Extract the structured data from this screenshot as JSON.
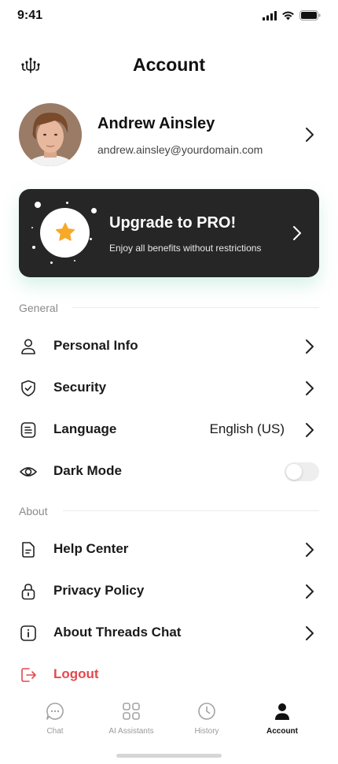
{
  "status_bar": {
    "time": "9:41"
  },
  "header": {
    "title": "Account",
    "logo_icon": "app-logo-icon"
  },
  "profile": {
    "name": "Andrew Ainsley",
    "email": "andrew.ainsley@yourdomain.com"
  },
  "pro_card": {
    "title": "Upgrade to PRO!",
    "subtitle": "Enjoy all benefits without restrictions",
    "icon": "star-icon",
    "star_color": "#f7a928"
  },
  "sections": {
    "general": {
      "label": "General",
      "items": [
        {
          "label": "Personal Info",
          "icon": "user-icon"
        },
        {
          "label": "Security",
          "icon": "shield-icon"
        },
        {
          "label": "Language",
          "icon": "document-icon",
          "value": "English (US)"
        },
        {
          "label": "Dark Mode",
          "icon": "eye-icon",
          "toggle": false
        }
      ]
    },
    "about": {
      "label": "About",
      "items": [
        {
          "label": "Help Center",
          "icon": "help-document-icon"
        },
        {
          "label": "Privacy Policy",
          "icon": "lock-icon"
        },
        {
          "label": "About Threads Chat",
          "icon": "info-icon"
        }
      ]
    }
  },
  "logout": {
    "label": "Logout",
    "color": "#e5484d"
  },
  "tabbar": {
    "tabs": [
      {
        "label": "Chat",
        "icon": "chat-icon",
        "active": false
      },
      {
        "label": "AI Assistants",
        "icon": "grid-icon",
        "active": false
      },
      {
        "label": "History",
        "icon": "clock-icon",
        "active": false
      },
      {
        "label": "Account",
        "icon": "account-icon",
        "active": true
      }
    ]
  }
}
